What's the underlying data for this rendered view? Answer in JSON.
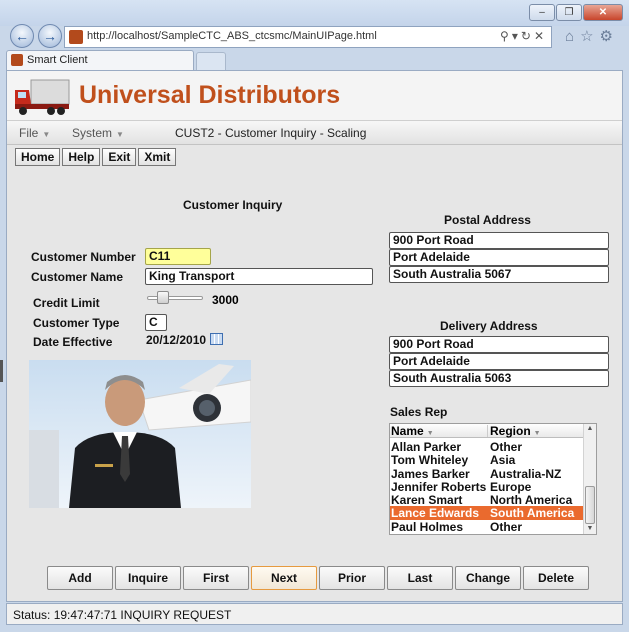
{
  "browser": {
    "address_url": "http://localhost/SampleCTC_ABS_ctcsmc/MainUIPage.html",
    "tab_title": "Smart Client",
    "window_buttons": [
      "–",
      "❐",
      "✕"
    ]
  },
  "app": {
    "brand": "Universal Distributors",
    "menus": [
      {
        "label": "File"
      },
      {
        "label": "System"
      }
    ],
    "screen_title": "CUST2 - Customer Inquiry - Scaling",
    "toolbar": [
      "Home",
      "Help",
      "Exit",
      "Xmit"
    ]
  },
  "form": {
    "heading": "Customer Inquiry",
    "customer_number": {
      "label": "Customer Number",
      "value": "C11"
    },
    "customer_name": {
      "label": "Customer Name",
      "value": "King Transport"
    },
    "credit_limit": {
      "label": "Credit Limit",
      "value": "3000"
    },
    "customer_type": {
      "label": "Customer Type",
      "value": "C"
    },
    "date_effective": {
      "label": "Date Effective",
      "value": "20/12/2010"
    }
  },
  "postal_address": {
    "heading": "Postal Address",
    "line1": "900 Port Road",
    "line2": "Port Adelaide",
    "line3": "South Australia 5067"
  },
  "delivery_address": {
    "heading": "Delivery Address",
    "line1": "900 Port Road",
    "line2": "Port Adelaide",
    "line3": "South Australia 5063"
  },
  "sales_rep": {
    "heading": "Sales Rep",
    "columns": [
      "Name",
      "Region"
    ],
    "rows": [
      {
        "name": "Allan Parker",
        "region": "Other"
      },
      {
        "name": "Tom Whiteley",
        "region": "Asia"
      },
      {
        "name": "James Barker",
        "region": "Australia-NZ"
      },
      {
        "name": "Jennifer Roberts",
        "region": "Europe"
      },
      {
        "name": "Karen Smart",
        "region": "North America"
      },
      {
        "name": "Lance Edwards",
        "region": "South America",
        "selected": true
      },
      {
        "name": "Paul Holmes",
        "region": "Other"
      }
    ]
  },
  "actions": [
    "Add",
    "Inquire",
    "First",
    "Next",
    "Prior",
    "Last",
    "Change",
    "Delete"
  ],
  "status": {
    "text": "Status: 19:47:47:71 INQUIRY REQUEST"
  },
  "colors": {
    "brand": "#c0501c",
    "selected_row": "#ea6a2e",
    "highlight_field": "#ffff9a"
  }
}
